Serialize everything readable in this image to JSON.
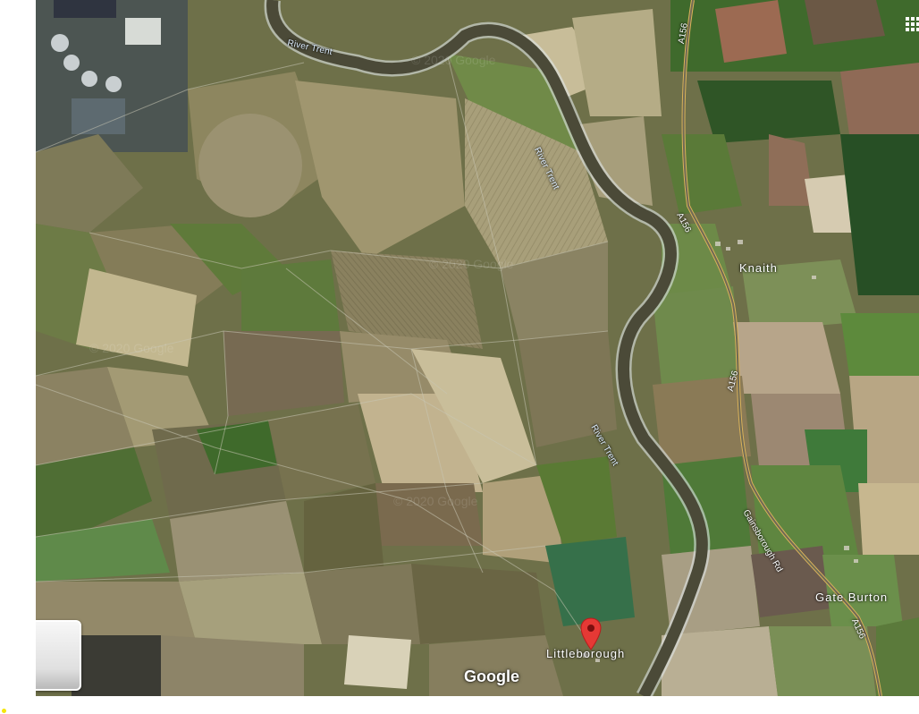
{
  "map": {
    "type": "satellite",
    "colors": {
      "field_dark": "#5a6238",
      "field_light": "#b9ae86",
      "river": "#4e4f3a",
      "river_edge": "#dfe6e8",
      "road_edge": "#d9b25a",
      "pin": "#e53935"
    }
  },
  "labels": {
    "river_1": "River Trent",
    "river_2": "River Trent",
    "river_3": "River Trent",
    "road_1": "A156",
    "road_2": "A156",
    "road_3": "A156",
    "road_4": "A156",
    "road_5": "Gainsborough Rd",
    "place_knaith": "Knaith",
    "place_gate_burton": "Gate Burton",
    "place_littleborough": "Littleborough"
  },
  "controls": {
    "attribution": "Google",
    "layers_icon": "apps-grid-icon",
    "marker_icon": "map-pin-icon"
  }
}
